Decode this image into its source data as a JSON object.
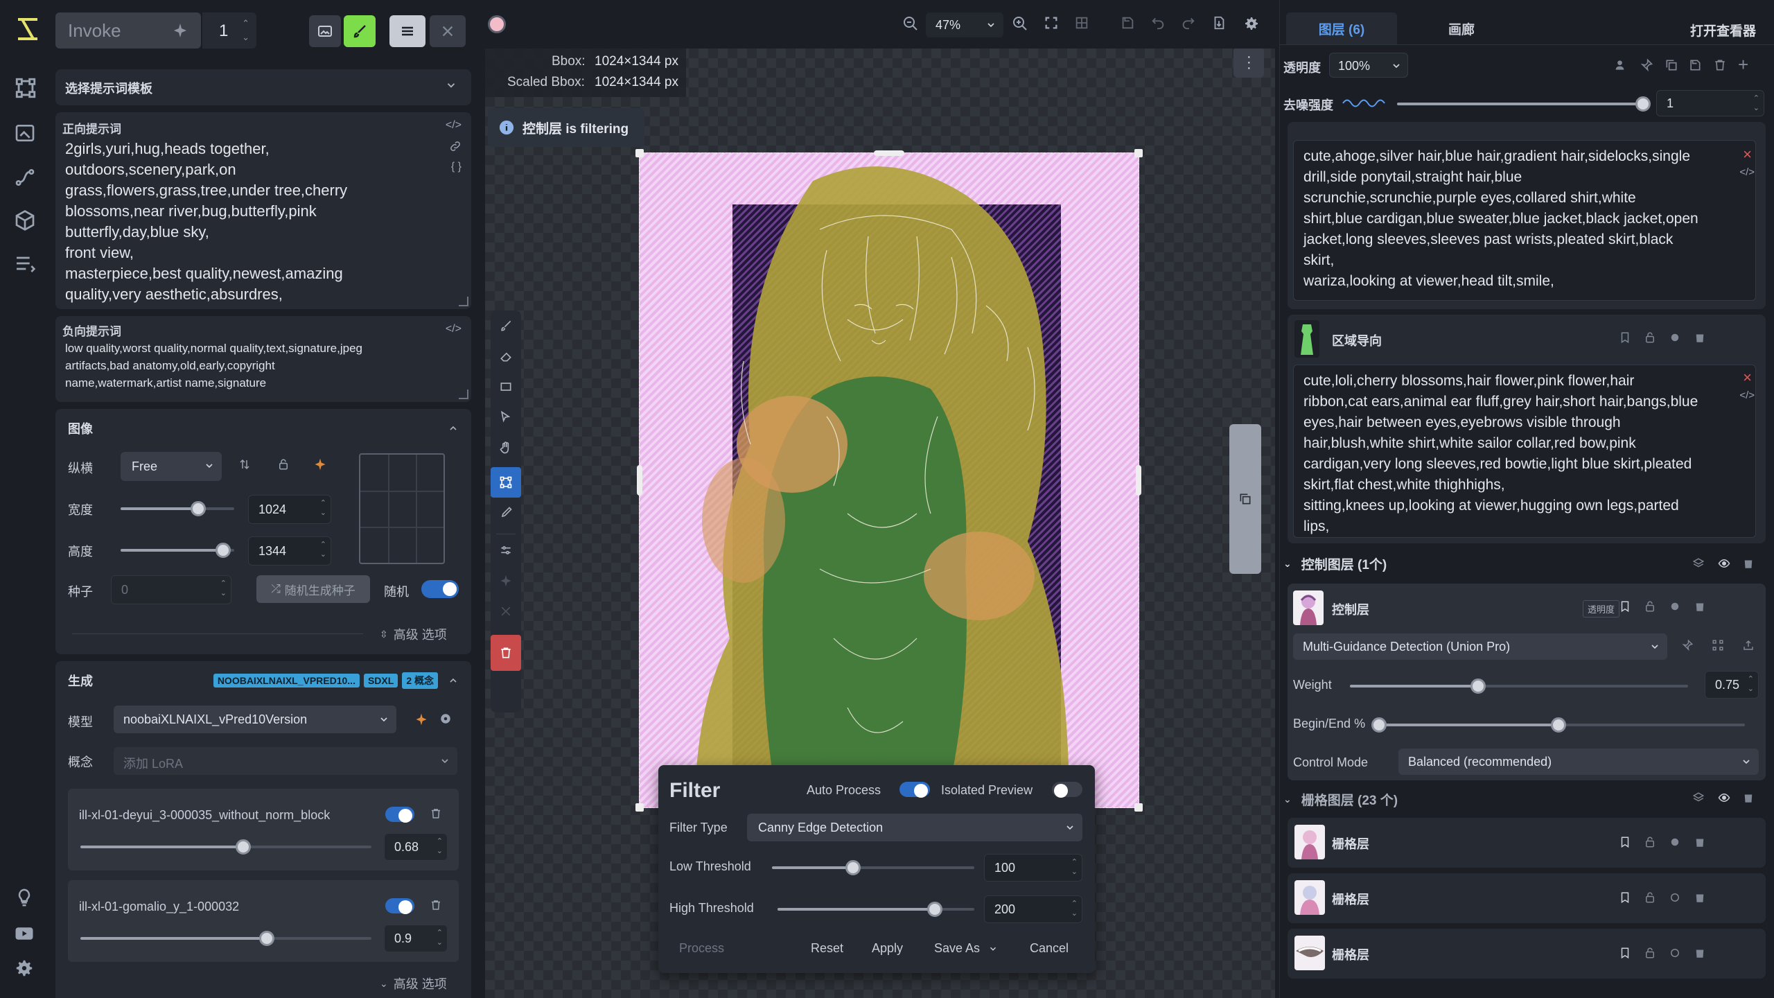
{
  "rail": {
    "items": [
      "logo",
      "workflow",
      "canvas",
      "nodes",
      "models",
      "queue"
    ],
    "bottom": [
      "bulb",
      "video",
      "settings"
    ]
  },
  "left": {
    "invoke_label": "Invoke",
    "batch": "1",
    "prompt_template": "选择提示词模板",
    "positive": {
      "label": "正向提示词",
      "lines": [
        "2girls,yuri,hug,heads together,",
        "outdoors,scenery,park,on",
        "grass,flowers,grass,tree,under tree,cherry",
        "blossoms,near river,bug,butterfly,pink",
        "butterfly,day,blue sky,",
        "front view,",
        "masterpiece,best quality,newest,amazing",
        "quality,very aesthetic,absurdres,"
      ]
    },
    "negative": {
      "label": "负向提示词",
      "lines": [
        "low quality,worst quality,normal quality,text,signature,jpeg",
        "artifacts,bad anatomy,old,early,copyright",
        "name,watermark,artist name,signature"
      ]
    },
    "image": {
      "title": "图像",
      "aspect_label": "纵横",
      "aspect_value": "Free",
      "width_label": "宽度",
      "width_value": "1024",
      "width_frac": 0.68,
      "height_label": "高度",
      "height_value": "1344",
      "height_frac": 0.9,
      "seed_label": "种子",
      "seed_value": "0",
      "random_seed_btn": "随机生成种子",
      "random_label": "随机",
      "advanced": "高级 选项"
    },
    "generation": {
      "title": "生成",
      "badges": [
        "NOOBAIXLNAIXL_VPRED10...",
        "SDXL",
        "2 概念"
      ],
      "model_label": "模型",
      "model_value": "noobaiXLNAIXL_vPred10Version",
      "concept_label": "概念",
      "lora_placeholder": "添加 LoRA",
      "loras": [
        {
          "name": "ill-xl-01-deyui_3-000035_without_norm_block",
          "weight": "0.68",
          "frac": 0.56
        },
        {
          "name": "ill-xl-01-gomalio_y_1-000032",
          "weight": "0.9",
          "frac": 0.64
        }
      ],
      "advanced": "高级 选项"
    }
  },
  "canvas": {
    "zoom": "47%",
    "bbox": "1024×1344 px",
    "scaled_bbox": "1024×1344 px",
    "bbox_label": "Bbox:",
    "scaled_label": "Scaled Bbox:",
    "toast": "控制层 is filtering"
  },
  "filter": {
    "title": "Filter",
    "auto_process": "Auto Process",
    "isolated_preview": "Isolated Preview",
    "filter_type_label": "Filter Type",
    "filter_type_value": "Canny Edge Detection",
    "low_label": "Low Threshold",
    "low_value": "100",
    "low_frac": 0.4,
    "high_label": "High Threshold",
    "high_value": "200",
    "high_frac": 0.8,
    "process": "Process",
    "reset": "Reset",
    "apply": "Apply",
    "save_as": "Save As",
    "cancel": "Cancel"
  },
  "right": {
    "tabs": [
      "图层 (6)",
      "画廊"
    ],
    "open_viewer": "打开查看器",
    "opacity_label": "透明度",
    "opacity_value": "100%",
    "denoise_label": "去噪强度",
    "denoise_value": "1",
    "region1_prompt": [
      "cute,ahoge,silver hair,blue hair,gradient hair,sidelocks,single",
      "drill,side ponytail,straight hair,blue",
      "scrunchie,scrunchie,purple eyes,collared shirt,white",
      "shirt,blue cardigan,blue sweater,blue jacket,black jacket,open",
      "jacket,long sleeves,sleeves past wrists,pleated skirt,black",
      "skirt,",
      "wariza,looking at viewer,head tilt,smile,"
    ],
    "region2_title": "区域导向",
    "region2_prompt": [
      "cute,loli,cherry blossoms,hair flower,pink flower,hair",
      "ribbon,cat ears,animal ear fluff,grey hair,short hair,bangs,blue",
      "eyes,hair between eyes,eyebrows visible through",
      "hair,blush,white shirt,white sailor collar,red bow,pink",
      "cardigan,very long sleeves,red bowtie,light blue skirt,pleated",
      "skirt,flat chest,white thighhighs,",
      "sitting,knees up,looking at viewer,hugging own legs,parted",
      "lips,"
    ],
    "control_group": "控制图层 (1个)",
    "control_layer": "控制层",
    "control_badge": "透明度",
    "control_model": "Multi-Guidance Detection (Union Pro)",
    "weight_label": "Weight",
    "weight_value": "0.75",
    "weight_frac": 0.38,
    "begin_end_label": "Begin/End %",
    "begin_frac": 0.0,
    "end_frac": 0.49,
    "control_mode_label": "Control Mode",
    "control_mode_value": "Balanced (recommended)",
    "raster_group": "栅格图层 (23 个)",
    "raster_layers": [
      "栅格层",
      "栅格层",
      "栅格层"
    ]
  },
  "colors": {
    "accent": "#2d6cc4",
    "badge": "#3aa0d8",
    "danger": "#c94a4a",
    "brush_active": "#7ddc4a"
  }
}
